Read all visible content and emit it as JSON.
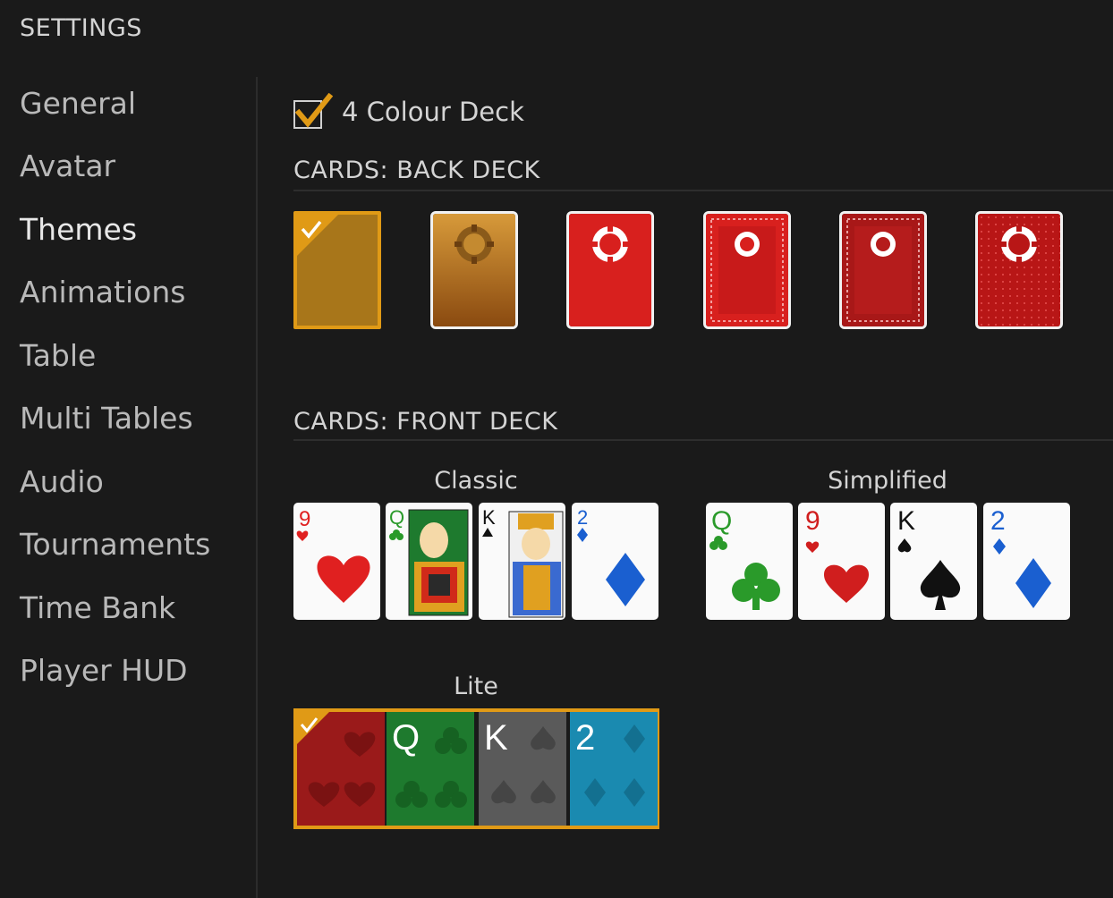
{
  "header": {
    "title": "SETTINGS"
  },
  "sidebar": {
    "items": [
      {
        "label": "General"
      },
      {
        "label": "Avatar"
      },
      {
        "label": "Themes"
      },
      {
        "label": "Animations"
      },
      {
        "label": "Table"
      },
      {
        "label": "Multi Tables"
      },
      {
        "label": "Audio"
      },
      {
        "label": "Tournaments"
      },
      {
        "label": "Time Bank"
      },
      {
        "label": "Player HUD"
      }
    ],
    "active": "Themes"
  },
  "options": {
    "four_colour_deck": {
      "label": "4 Colour Deck",
      "checked": true
    }
  },
  "back_deck": {
    "title": "CARDS: BACK DECK",
    "selected_index": 0,
    "count": 6
  },
  "front_deck": {
    "title": "CARDS: FRONT DECK",
    "decks": [
      {
        "label": "Classic",
        "cards": [
          "9",
          "Q",
          "K",
          "2"
        ]
      },
      {
        "label": "Simplified",
        "cards": [
          "Q",
          "9",
          "K",
          "2"
        ]
      },
      {
        "label": "Lite",
        "cards": [
          "Q",
          "K",
          "2"
        ]
      }
    ],
    "selected": "Lite"
  },
  "colors": {
    "accent": "#e09a16",
    "background": "#1a1a1a",
    "heart": "#e02020",
    "club": "#2a9a2a",
    "spade": "#111111",
    "diamond": "#1a5fd0"
  }
}
